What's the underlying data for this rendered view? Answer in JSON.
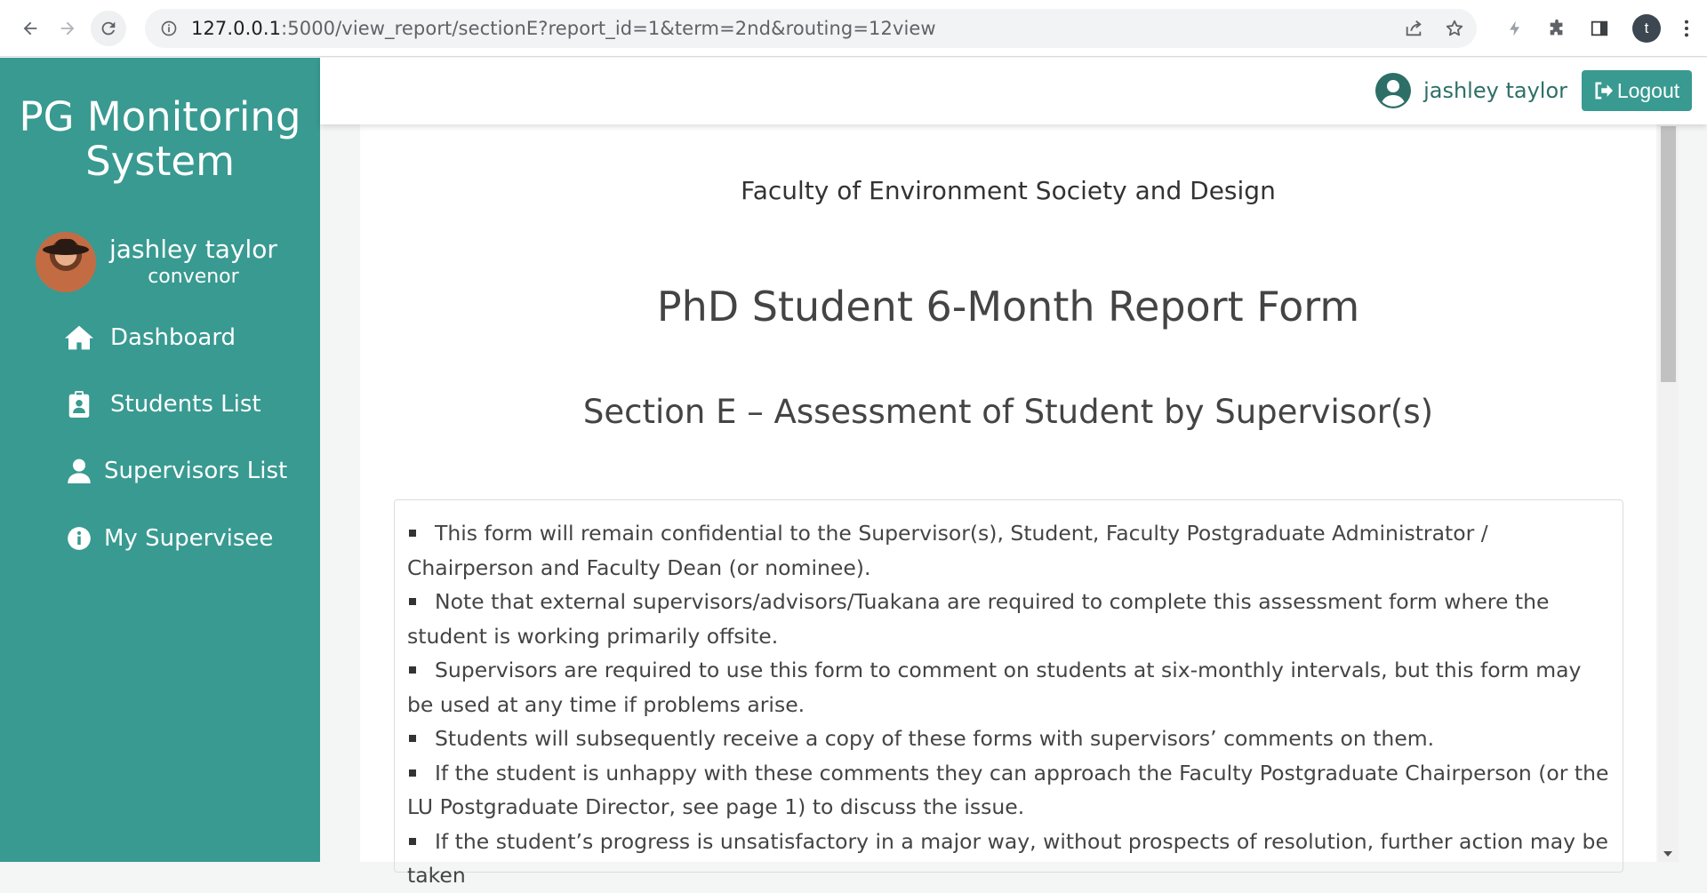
{
  "browser": {
    "url_host": "127.0.0.1",
    "url_rest": ":5000/view_report/sectionE?report_id=1&term=2nd&routing=12view",
    "profile_initial": "t"
  },
  "sidebar": {
    "brand": "PG Monitoring System",
    "user_name": "jashley taylor",
    "user_role": "convenor",
    "items": [
      {
        "label": "Dashboard",
        "icon": "home-icon"
      },
      {
        "label": "Students List",
        "icon": "clipboard-user-icon"
      },
      {
        "label": "Supervisors List",
        "icon": "user-icon"
      },
      {
        "label": "My Supervisee",
        "icon": "info-circle-icon"
      }
    ]
  },
  "topbar": {
    "user_name": "jashley taylor",
    "logout_label": "Logout"
  },
  "main": {
    "faculty": "Faculty of Environment Society and Design",
    "form_title": "PhD Student 6-Month Report Form",
    "section_title": "Section E – Assessment of Student by Supervisor(s)",
    "notes": [
      "This form will remain confidential to the Supervisor(s), Student, Faculty Postgraduate Administrator / Chairperson and Faculty Dean (or nominee).",
      "Note that external supervisors/advisors/Tuakana are required to complete this assessment form where the student is working primarily offsite.",
      "Supervisors are required to use this form to comment on students at six-monthly intervals, but this form may be used at any time if problems arise.",
      "Students will subsequently receive a copy of these forms with supervisors’ comments on them.",
      "If the student is unhappy with these comments they can approach the Faculty Postgraduate Chairperson (or the LU Postgraduate Director, see page 1) to discuss the issue.",
      "If the student’s progress is unsatisfactory in a major way, without prospects of resolution, further action may be taken"
    ]
  },
  "colors": {
    "brand_teal": "#389a91",
    "dark_teal_text": "#2d6f66"
  }
}
